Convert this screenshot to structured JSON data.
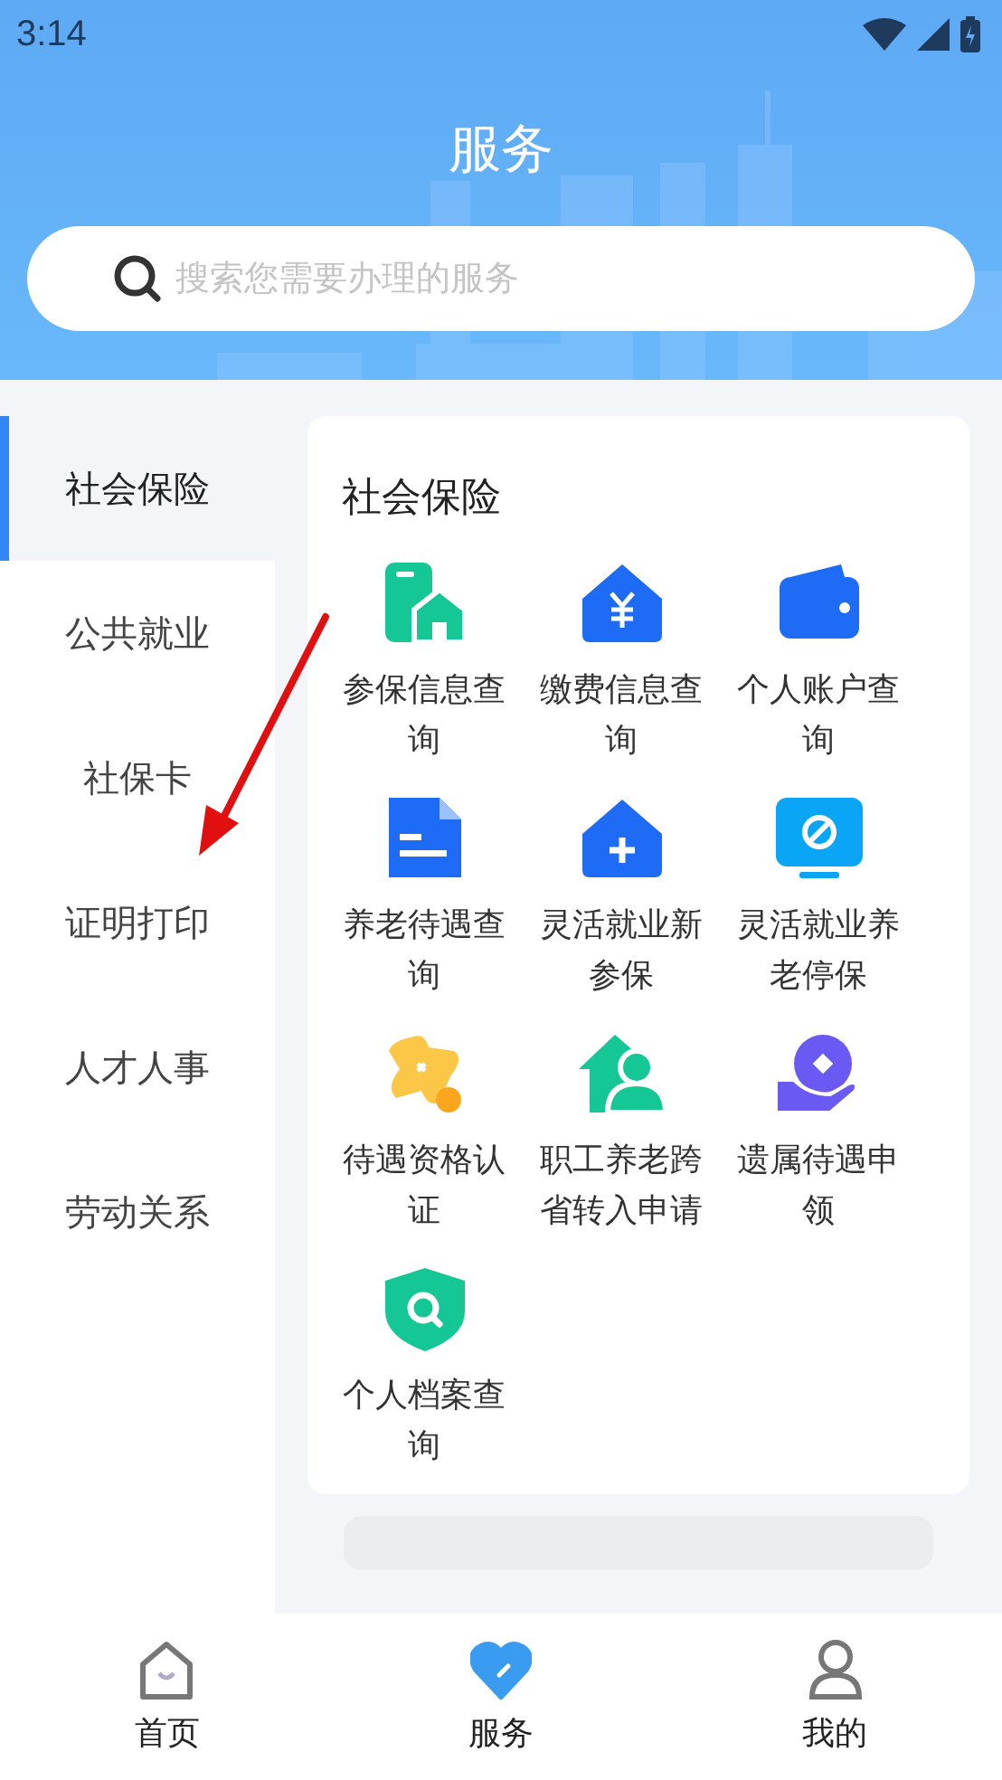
{
  "status_bar": {
    "time": "3:14"
  },
  "header": {
    "title": "服务"
  },
  "search": {
    "placeholder": "搜索您需要办理的服务"
  },
  "sidebar": {
    "items": [
      {
        "label": "社会保险",
        "selected": true
      },
      {
        "label": "公共就业",
        "selected": false
      },
      {
        "label": "社保卡",
        "selected": false
      },
      {
        "label": "证明打印",
        "selected": false
      },
      {
        "label": "人才人事",
        "selected": false
      },
      {
        "label": "劳动关系",
        "selected": false
      }
    ]
  },
  "section": {
    "title": "社会保险",
    "services": [
      {
        "label": "参保信息查询"
      },
      {
        "label": "缴费信息查询"
      },
      {
        "label": "个人账户查询"
      },
      {
        "label": "养老待遇查询"
      },
      {
        "label": "灵活就业新参保"
      },
      {
        "label": "灵活就业养老停保"
      },
      {
        "label": "待遇资格认证"
      },
      {
        "label": "职工养老跨省转入申请"
      },
      {
        "label": "遗属待遇申领"
      },
      {
        "label": "个人档案查询"
      }
    ]
  },
  "bottom_nav": [
    {
      "label": "首页",
      "selected": false
    },
    {
      "label": "服务",
      "selected": true
    },
    {
      "label": "我的",
      "selected": false
    }
  ]
}
